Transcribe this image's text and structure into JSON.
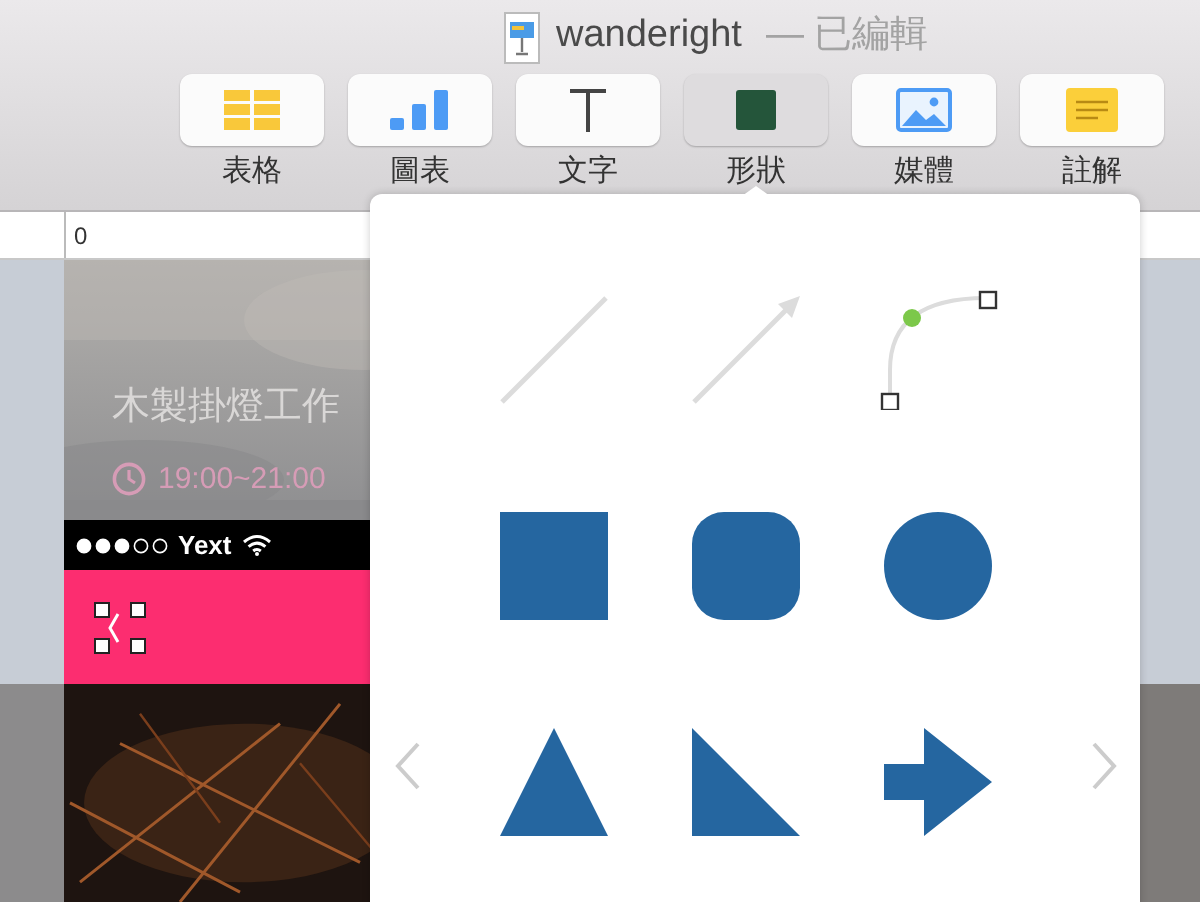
{
  "window": {
    "title": "wanderight",
    "status": "— 已編輯"
  },
  "toolbar": [
    {
      "label": "表格",
      "kind": "table",
      "selected": false
    },
    {
      "label": "圖表",
      "kind": "chart",
      "selected": false
    },
    {
      "label": "文字",
      "kind": "text",
      "selected": false
    },
    {
      "label": "形狀",
      "kind": "shape",
      "selected": true
    },
    {
      "label": "媒體",
      "kind": "media",
      "selected": false
    },
    {
      "label": "註解",
      "kind": "comment",
      "selected": false
    }
  ],
  "ruler": {
    "mark": "0"
  },
  "slide": {
    "title": "木製掛燈工作",
    "time": "19:00~21:00",
    "carrier": "Yext"
  },
  "shapes_popover": {
    "shapes": [
      {
        "kind": "line"
      },
      {
        "kind": "arrow"
      },
      {
        "kind": "curve"
      },
      {
        "kind": "square"
      },
      {
        "kind": "rounded-square"
      },
      {
        "kind": "circle"
      },
      {
        "kind": "triangle"
      },
      {
        "kind": "right-triangle"
      },
      {
        "kind": "arrow-shape"
      }
    ]
  }
}
